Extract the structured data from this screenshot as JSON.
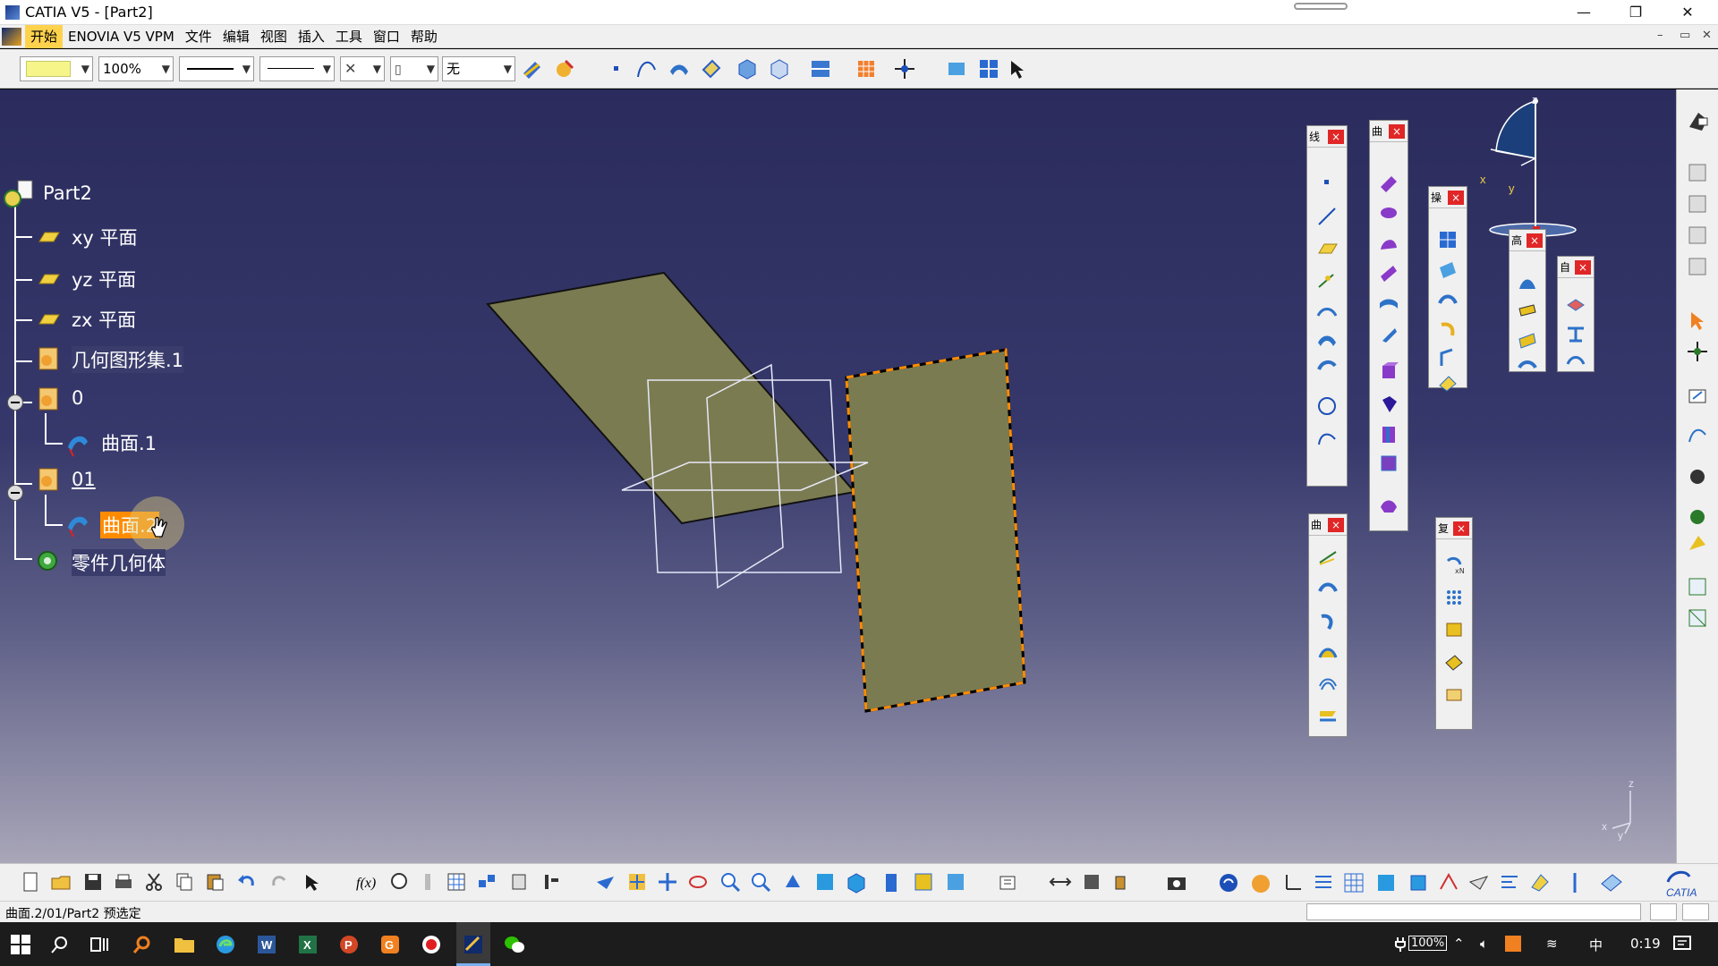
{
  "window": {
    "title": "CATIA V5 - [Part2]",
    "min": "—",
    "restore": "❐",
    "close": "✕"
  },
  "menu": {
    "items": [
      "开始",
      "ENOVIA V5 VPM",
      "文件",
      "编辑",
      "视图",
      "插入",
      "工具",
      "窗口",
      "帮助"
    ],
    "mdi_min": "–",
    "mdi_restore": "▭",
    "mdi_close": "✕"
  },
  "toolbar": {
    "color_value": "",
    "zoom_value": "100%",
    "layer_value": "无"
  },
  "tree": {
    "root": "Part2",
    "xy": "xy 平面",
    "yz": "yz 平面",
    "zx": "zx 平面",
    "geoset1": "几何图形集.1",
    "set0": "0",
    "surface1": "曲面.1",
    "set01": "01",
    "surface2": "曲面.2",
    "body": "零件几何体"
  },
  "compass": {
    "z": "z",
    "x": "x",
    "y": "y"
  },
  "axis_indicator": {
    "z": "z",
    "x": "x",
    "y": "y"
  },
  "panels": {
    "p1": "线",
    "p2": "曲",
    "p3": "操",
    "p4": "高",
    "p5": "自",
    "p6": "曲",
    "p7": "复"
  },
  "status": {
    "text": "曲面.2/01/Part2 预选定"
  },
  "taskbar": {
    "battery": "100%",
    "ime": "中",
    "time": "0:19"
  },
  "colors": {
    "accent": "#ffd24d",
    "surface_fill": "#7b7b52",
    "selection": "#ff8c00"
  }
}
